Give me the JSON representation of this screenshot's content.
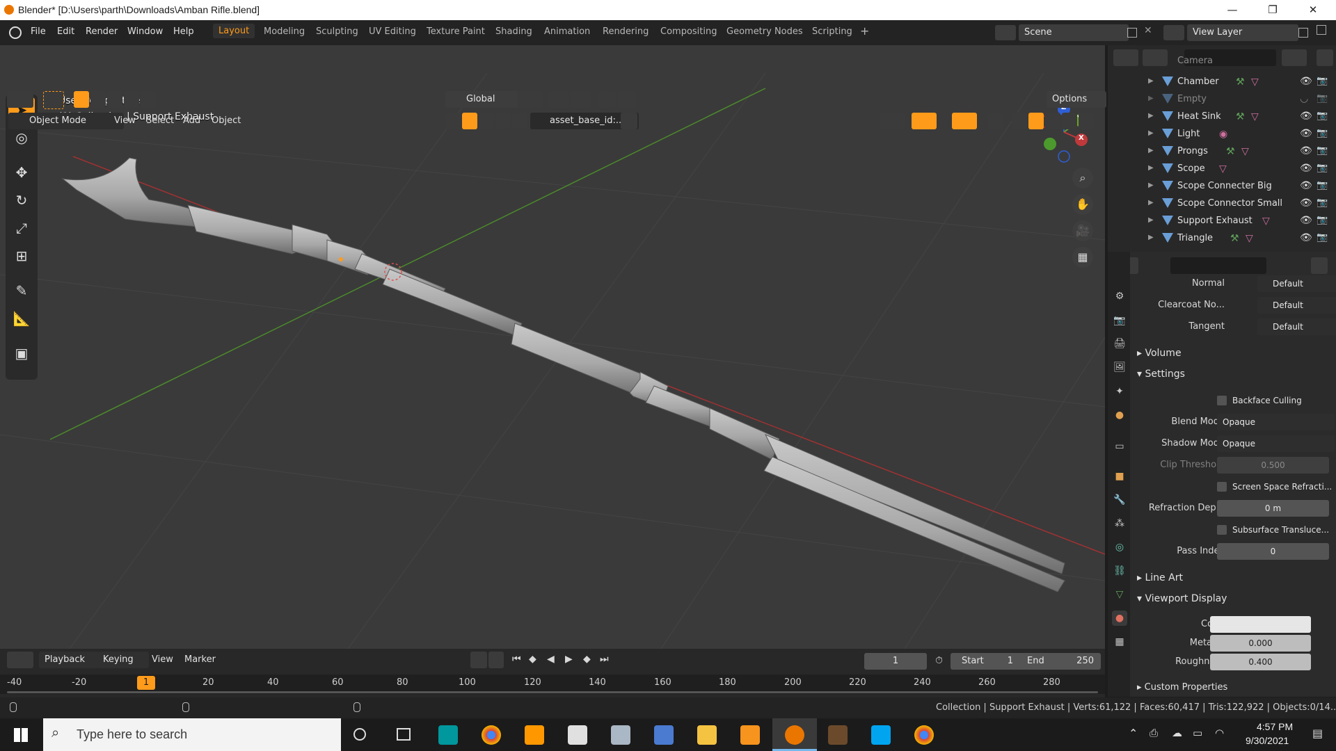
{
  "window": {
    "title": "Blender* [D:\\Users\\parth\\Downloads\\Amban Rifle.blend]",
    "minimize": "—",
    "maximize": "❐",
    "close": "✕"
  },
  "menu": [
    "File",
    "Edit",
    "Render",
    "Window",
    "Help"
  ],
  "workspaces": [
    "Layout",
    "Modeling",
    "Sculpting",
    "UV Editing",
    "Texture Paint",
    "Shading",
    "Animation",
    "Rendering",
    "Compositing",
    "Geometry Nodes",
    "Scripting"
  ],
  "active_workspace": "Layout",
  "scene": "Scene",
  "view_layer": "View Layer",
  "viewport_header": {
    "transform_orientation": "Global",
    "options": "Options",
    "mode": "Object Mode",
    "menus": [
      "View",
      "Select",
      "Add",
      "Object"
    ],
    "asset_field": "asset_base_id:..."
  },
  "viewport": {
    "perspective": "User Perspective",
    "collection_info": "(1) Collection | Support Exhaust",
    "gizmo_axes": [
      "X",
      "Y",
      "Z"
    ]
  },
  "outliner": {
    "items": [
      {
        "label": "Camera",
        "dim": true
      },
      {
        "label": "Chamber",
        "dim": false
      },
      {
        "label": "Empty",
        "dim": true
      },
      {
        "label": "Heat Sink",
        "dim": false
      },
      {
        "label": "Light",
        "dim": false
      },
      {
        "label": "Prongs",
        "dim": false
      },
      {
        "label": "Scope",
        "dim": false
      },
      {
        "label": "Scope Connecter Big",
        "dim": false
      },
      {
        "label": "Scope Connector Small",
        "dim": false
      },
      {
        "label": "Support Exhaust",
        "dim": false
      },
      {
        "label": "Triangle",
        "dim": false
      }
    ]
  },
  "properties": {
    "inputs": [
      {
        "label": "Normal",
        "value": "Default"
      },
      {
        "label": "Clearcoat No...",
        "value": "Default"
      },
      {
        "label": "Tangent",
        "value": "Default"
      }
    ],
    "sections": {
      "volume": "Volume",
      "settings": "Settings",
      "line_art": "Line Art",
      "viewport_display": "Viewport Display",
      "custom_properties": "Custom Properties"
    },
    "backface_culling": "Backface Culling",
    "blend_mode": {
      "label": "Blend Mode",
      "value": "Opaque"
    },
    "shadow_mode": {
      "label": "Shadow Mode",
      "value": "Opaque"
    },
    "clip_threshold": {
      "label": "Clip Threshold",
      "value": "0.500"
    },
    "screen_space_refraction": "Screen Space Refracti...",
    "refraction_depth": {
      "label": "Refraction Dep...",
      "value": "0 m"
    },
    "subsurface_translucency": "Subsurface Transluce...",
    "pass_index": {
      "label": "Pass Index",
      "value": "0"
    },
    "color": {
      "label": "Color",
      "value": "#e6e6e6"
    },
    "metallic": {
      "label": "Metallic",
      "value": "0.000"
    },
    "roughness": {
      "label": "Roughness",
      "value": "0.400"
    }
  },
  "timeline": {
    "menus": [
      "Playback",
      "Keying",
      "View",
      "Marker"
    ],
    "current_frame": "1",
    "start_label": "Start",
    "start": "1",
    "end_label": "End",
    "end": "250",
    "ruler": [
      "-40",
      "-20",
      "1",
      "20",
      "40",
      "60",
      "80",
      "100",
      "120",
      "140",
      "160",
      "180",
      "200",
      "220",
      "240",
      "260",
      "280"
    ]
  },
  "statusbar": "Collection | Support Exhaust | Verts:61,122 | Faces:60,417 | Tris:122,922 | Objects:0/14...",
  "taskbar": {
    "search_placeholder": "Type here to search",
    "time": "4:57 PM",
    "date": "9/30/2021"
  },
  "colors": {
    "accent": "#ff9b1a",
    "viewport_bg": "#3a3a3a",
    "x_axis": "#c0393b",
    "y_axis": "#6aa326",
    "z_axis": "#2f5fd6"
  }
}
